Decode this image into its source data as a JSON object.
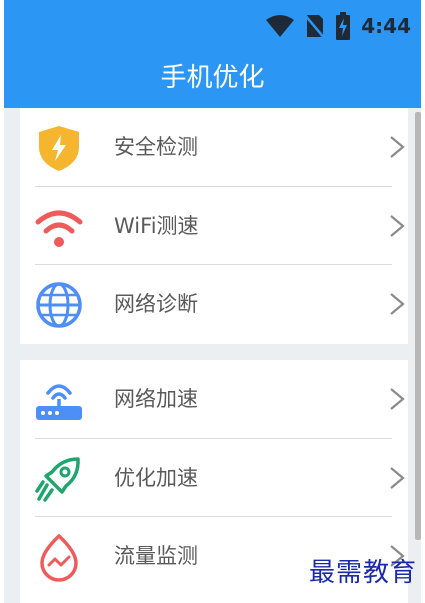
{
  "status_bar": {
    "time": "4:44",
    "icons": [
      "wifi-icon",
      "no-sim-icon",
      "battery-charging-icon"
    ]
  },
  "app_bar": {
    "title": "手机优化"
  },
  "sections": [
    {
      "items": [
        {
          "label": "安全检测",
          "icon": "shield-bolt-icon",
          "color": "#f5b52e"
        },
        {
          "label": "WiFi测速",
          "icon": "wifi-signal-icon",
          "color": "#ef5a5a"
        },
        {
          "label": "网络诊断",
          "icon": "globe-icon",
          "color": "#4e8ef7"
        }
      ]
    },
    {
      "items": [
        {
          "label": "网络加速",
          "icon": "router-icon",
          "color": "#4e8ef7"
        },
        {
          "label": "优化加速",
          "icon": "rocket-icon",
          "color": "#20a56e"
        },
        {
          "label": "流量监测",
          "icon": "traffic-drop-icon",
          "color": "#ef5a5a"
        }
      ]
    }
  ],
  "watermark": "最需教育",
  "colors": {
    "primary": "#2b96f3",
    "background": "#eceff1"
  }
}
